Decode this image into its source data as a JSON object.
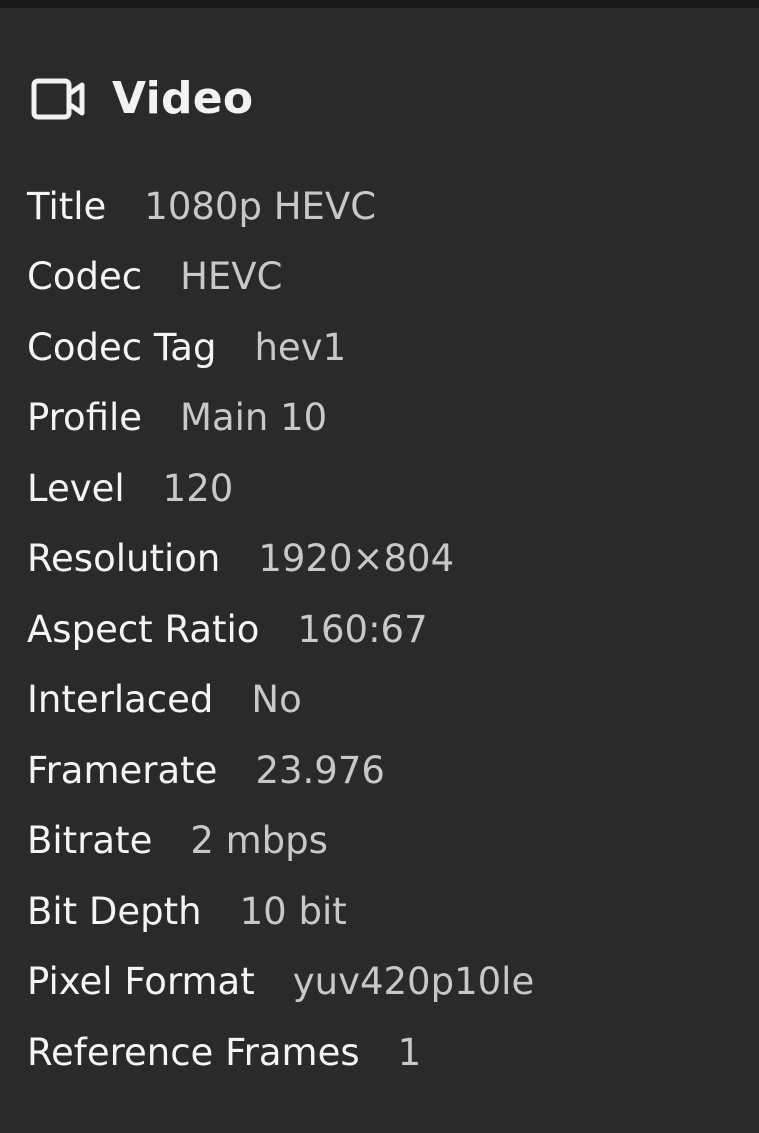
{
  "section": {
    "title": "Video",
    "icon": "video-camera-icon"
  },
  "colors": {
    "background": "#2a2a2a",
    "top_strip": "#191919",
    "label": "#f4f4f4",
    "value": "#c8c8c8"
  },
  "properties": [
    {
      "label": "Title",
      "value": "1080p HEVC"
    },
    {
      "label": "Codec",
      "value": "HEVC"
    },
    {
      "label": "Codec Tag",
      "value": "hev1"
    },
    {
      "label": "Profile",
      "value": "Main 10"
    },
    {
      "label": "Level",
      "value": "120"
    },
    {
      "label": "Resolution",
      "value": "1920×804"
    },
    {
      "label": "Aspect Ratio",
      "value": "160:67"
    },
    {
      "label": "Interlaced",
      "value": "No"
    },
    {
      "label": "Framerate",
      "value": "23.976"
    },
    {
      "label": "Bitrate",
      "value": "2 mbps"
    },
    {
      "label": "Bit Depth",
      "value": "10 bit"
    },
    {
      "label": "Pixel Format",
      "value": "yuv420p10le"
    },
    {
      "label": "Reference Frames",
      "value": "1"
    }
  ]
}
